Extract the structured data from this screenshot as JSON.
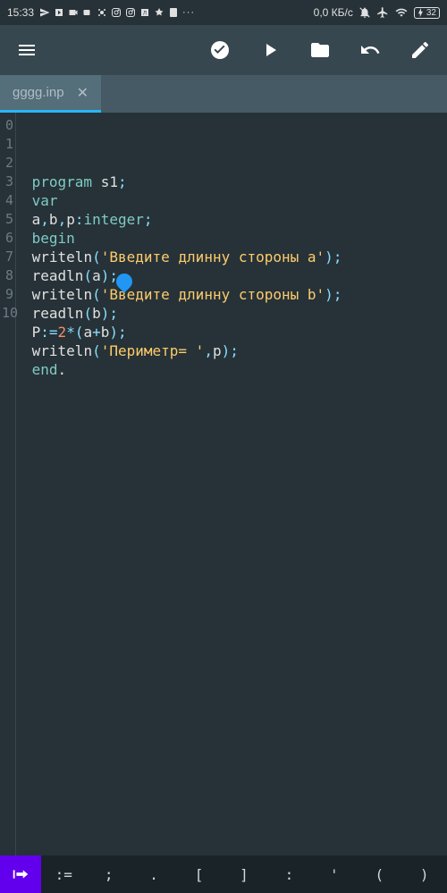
{
  "status": {
    "time": "15:33",
    "net_text": "0,0 КБ/с",
    "battery": "32"
  },
  "tabs": [
    {
      "name": "gggg.inp"
    }
  ],
  "code": {
    "lines": [
      {
        "n": "0",
        "tokens": [
          [
            "kw",
            " program "
          ],
          [
            "id",
            "s1"
          ],
          [
            "pn",
            ";"
          ]
        ]
      },
      {
        "n": "1",
        "tokens": [
          [
            "kw",
            " var"
          ]
        ]
      },
      {
        "n": "2",
        "tokens": [
          [
            "plain",
            " "
          ],
          [
            "id",
            "a"
          ],
          [
            "pn",
            ","
          ],
          [
            "id",
            "b"
          ],
          [
            "pn",
            ","
          ],
          [
            "id",
            "p"
          ],
          [
            "pn",
            ":"
          ],
          [
            "ty",
            "integer"
          ],
          [
            "pn",
            ";"
          ]
        ]
      },
      {
        "n": "3",
        "tokens": [
          [
            "kw",
            " begin"
          ]
        ]
      },
      {
        "n": "4",
        "tokens": [
          [
            "plain",
            " "
          ],
          [
            "fn",
            "writeln"
          ],
          [
            "pn",
            "("
          ],
          [
            "strq",
            "'Введите длинну стороны a'"
          ],
          [
            "pn",
            ")"
          ],
          [
            "pn",
            ";"
          ]
        ]
      },
      {
        "n": "5",
        "tokens": [
          [
            "plain",
            " "
          ],
          [
            "fn",
            "readln"
          ],
          [
            "pn",
            "("
          ],
          [
            "id",
            "a"
          ],
          [
            "pn",
            ")"
          ],
          [
            "pn",
            ";"
          ]
        ]
      },
      {
        "n": "6",
        "tokens": [
          [
            "plain",
            " "
          ],
          [
            "fn",
            "writeln"
          ],
          [
            "pn",
            "("
          ],
          [
            "strq",
            "'Введите длинну стороны b'"
          ],
          [
            "pn",
            ")"
          ],
          [
            "pn",
            ";"
          ]
        ]
      },
      {
        "n": "7",
        "tokens": [
          [
            "plain",
            " "
          ],
          [
            "fn",
            "readln"
          ],
          [
            "pn",
            "("
          ],
          [
            "id",
            "b"
          ],
          [
            "pn",
            ")"
          ],
          [
            "pn",
            ";"
          ]
        ]
      },
      {
        "n": "8",
        "tokens": [
          [
            "plain",
            " "
          ],
          [
            "id",
            "P"
          ],
          [
            "pn",
            ":="
          ],
          [
            "num",
            "2"
          ],
          [
            "pn",
            "*"
          ],
          [
            "pn",
            "("
          ],
          [
            "id",
            "a"
          ],
          [
            "pn",
            "+"
          ],
          [
            "id",
            "b"
          ],
          [
            "pn",
            ")"
          ],
          [
            "pn",
            ";"
          ]
        ]
      },
      {
        "n": "9",
        "tokens": [
          [
            "plain",
            " "
          ],
          [
            "fn",
            "writeln"
          ],
          [
            "pn",
            "("
          ],
          [
            "strq",
            "'Периметр= '"
          ],
          [
            "pn",
            ","
          ],
          [
            "id",
            "p"
          ],
          [
            "pn",
            ")"
          ],
          [
            "pn",
            ";"
          ]
        ]
      },
      {
        "n": "10",
        "tokens": [
          [
            "plain",
            " "
          ],
          [
            "kw",
            "end"
          ],
          [
            "plain",
            "."
          ]
        ]
      }
    ]
  },
  "toolbar": {
    "symbols": [
      ":=",
      ";",
      ".",
      "[",
      "]",
      ":",
      "'",
      "(",
      ")"
    ]
  }
}
